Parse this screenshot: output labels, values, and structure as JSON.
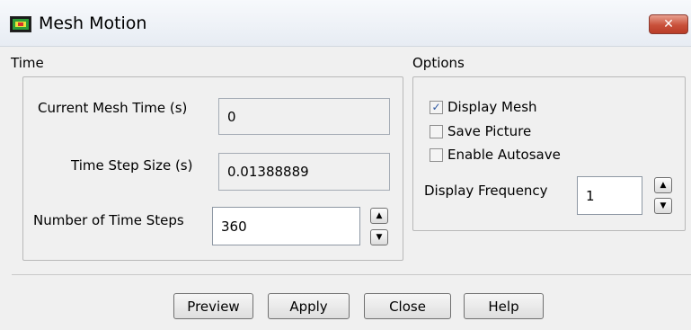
{
  "window": {
    "title": "Mesh Motion",
    "close_glyph": "✕"
  },
  "time_group": {
    "title": "Time",
    "current_mesh_time": {
      "label": "Current Mesh Time (s)",
      "value": "0"
    },
    "time_step_size": {
      "label": "Time Step Size (s)",
      "value": "0.01388889"
    },
    "number_of_time_steps": {
      "label": "Number of Time Steps",
      "value": "360"
    }
  },
  "options_group": {
    "title": "Options",
    "checkboxes": [
      {
        "label": "Display Mesh",
        "checked": true
      },
      {
        "label": "Save Picture",
        "checked": false
      },
      {
        "label": "Enable Autosave",
        "checked": false
      }
    ],
    "display_frequency": {
      "label": "Display Frequency",
      "value": "1"
    }
  },
  "buttons": {
    "preview": "Preview",
    "apply": "Apply",
    "close": "Close",
    "help": "Help"
  },
  "icons": {
    "up": "▲",
    "down": "▼",
    "check": "✓"
  }
}
